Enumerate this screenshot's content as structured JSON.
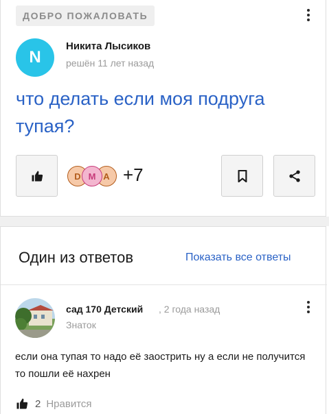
{
  "question": {
    "welcome_badge": "ДОБРО ПОЖАЛОВАТЬ",
    "author": {
      "initial": "N",
      "name": "Никита Лысиков",
      "meta": "решён 11 лет назад",
      "avatar_color": "#29c4e8"
    },
    "title": "что делать если моя подруга тупая?",
    "reactions": {
      "avatars": [
        {
          "letter": "D",
          "bg": "#f6c9a8",
          "fg": "#b25c1c"
        },
        {
          "letter": "M",
          "bg": "#f3b6cf",
          "fg": "#c73b7a"
        },
        {
          "letter": "A",
          "bg": "#f6c9a8",
          "fg": "#b25c1c"
        }
      ],
      "more": "+7"
    },
    "icons": {
      "like": "thumbs-up-icon",
      "bookmark": "bookmark-icon",
      "share": "share-icon",
      "menu": "more-vertical-icon"
    }
  },
  "answers": {
    "header": "Один из ответов",
    "show_all": "Показать все ответы",
    "answer": {
      "author": "сад 170 Детский",
      "time": ", 2 года назад",
      "rank": "Знаток",
      "text": "если она тупая то надо её заострить ну а если не получится то пошли её нахрен",
      "likes": "2",
      "like_label": "Нравится"
    }
  },
  "colors": {
    "link": "#2a62c6",
    "muted": "#9a9a9a",
    "border": "#dedede"
  }
}
